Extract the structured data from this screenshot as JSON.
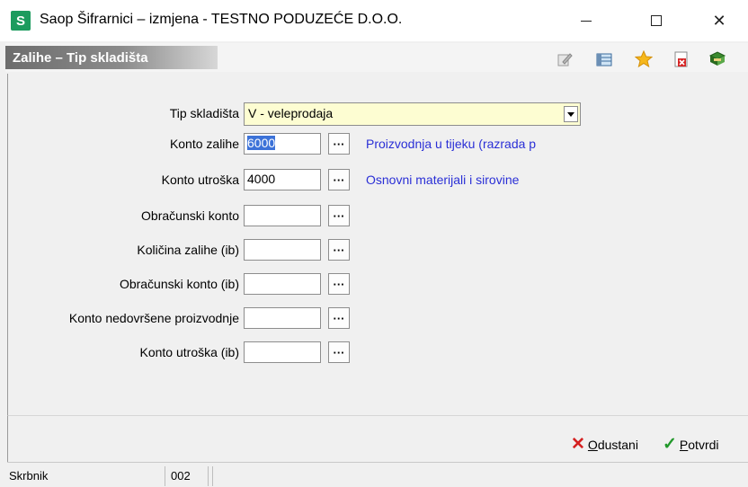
{
  "window": {
    "app_icon_letter": "S",
    "title": "Saop Šifrarnici – izmjena  - TESTNO PODUZEĆE D.O.O.",
    "minimize": "",
    "maximize": "",
    "close": "✕"
  },
  "panel": {
    "title": "Zalihe – Tip skladišta",
    "toolbar_icons": [
      "edit-icon",
      "grid-icon",
      "star-icon",
      "delete-document-icon",
      "book-icon"
    ]
  },
  "form": {
    "tip_skladista": {
      "label": "Tip skladišta",
      "value": "V - veleprodaja"
    },
    "konto_zalihe": {
      "label": "Konto zalihe",
      "value": "6000",
      "description": "Proizvodnja u tijeku (razrada p"
    },
    "konto_utroska": {
      "label": "Konto utroška",
      "value": "4000",
      "description": "Osnovni materijali i sirovine"
    },
    "obracunski_konto": {
      "label": "Obračunski konto",
      "value": ""
    },
    "kolicina_zalihe_ib": {
      "label": "Količina zalihe (ib)",
      "value": ""
    },
    "obracunski_konto_ib": {
      "label": "Obračunski konto (ib)",
      "value": ""
    },
    "konto_nedovrsene": {
      "label": "Konto nedovršene proizvodnje",
      "value": ""
    },
    "konto_utroska_ib": {
      "label": "Konto utroška (ib)",
      "value": ""
    },
    "dots": "···"
  },
  "footer": {
    "cancel_label": "Odustani",
    "confirm_label": "Potvrdi"
  },
  "status": {
    "user": "Skrbnik",
    "code": "002"
  },
  "colors": {
    "description_text": "#2a2fd6",
    "select_background": "#fdfdd2",
    "app_icon": "#1c9b5e",
    "selection": "#3c72d8"
  }
}
